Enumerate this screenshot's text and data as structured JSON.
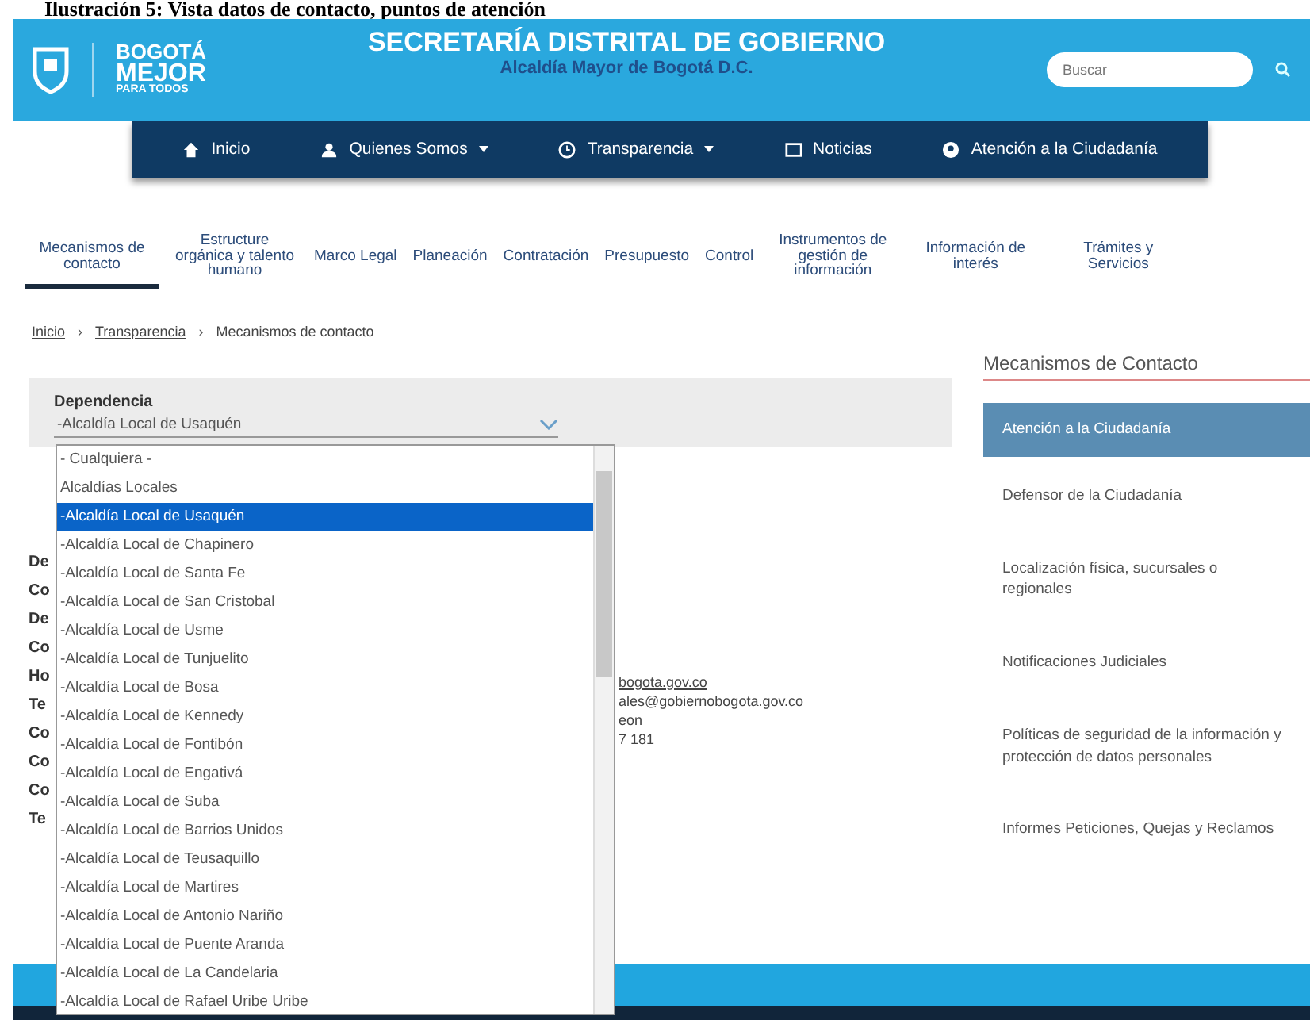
{
  "caption": "Ilustración 5: Vista datos de contacto, puntos de atención",
  "header": {
    "logo_lines": [
      "BOGOTÁ",
      "MEJOR",
      "PARA TODOS"
    ],
    "title": "SECRETARÍA DISTRITAL DE GOBIERNO",
    "subtitle": "Alcaldía Mayor de Bogotá D.C.",
    "search": {
      "placeholder": "Buscar"
    }
  },
  "nav": [
    {
      "label": "Inicio",
      "caret": false
    },
    {
      "label": "Quienes Somos",
      "caret": true
    },
    {
      "label": "Transparencia",
      "caret": true
    },
    {
      "label": "Noticias",
      "caret": false
    },
    {
      "label": "Atención a la Ciudadanía",
      "caret": false
    }
  ],
  "tabs": [
    {
      "label": "Mecanismos de contacto",
      "selected": true
    },
    {
      "label": "Estructure orgánica y talento humano",
      "selected": false
    },
    {
      "label": "Marco Legal",
      "selected": false
    },
    {
      "label": "Planeación",
      "selected": false
    },
    {
      "label": "Contratación",
      "selected": false
    },
    {
      "label": "Presupuesto",
      "selected": false
    },
    {
      "label": "Control",
      "selected": false
    },
    {
      "label": "Instrumentos de gestión de información",
      "selected": false
    },
    {
      "label": "Información de interés",
      "selected": false
    },
    {
      "label": "Trámites y Servicios",
      "selected": false
    }
  ],
  "breadcrumb": [
    {
      "label": "Inicio",
      "link": true
    },
    {
      "separator": "›",
      "label": "Transparencia",
      "link": true
    },
    {
      "separator": "›",
      "label": "Mecanismos de contacto",
      "link": false
    }
  ],
  "filter": {
    "label": "Dependencia",
    "value": "-Alcaldía Local de Usaquén",
    "options": [
      {
        "label": "- Cualquiera -",
        "selected": false
      },
      {
        "label": "Alcaldías Locales",
        "selected": false
      },
      {
        "label": "-Alcaldía Local de Usaquén",
        "selected": true
      },
      {
        "label": "-Alcaldía Local de Chapinero",
        "selected": false
      },
      {
        "label": "-Alcaldía Local de Santa Fe",
        "selected": false
      },
      {
        "label": "-Alcaldía Local de San Cristobal",
        "selected": false
      },
      {
        "label": "-Alcaldía Local de Usme",
        "selected": false
      },
      {
        "label": "-Alcaldía Local de Tunjuelito",
        "selected": false
      },
      {
        "label": "-Alcaldía Local de Bosa",
        "selected": false
      },
      {
        "label": "-Alcaldía Local de Kennedy",
        "selected": false
      },
      {
        "label": "-Alcaldía Local de Fontibón",
        "selected": false
      },
      {
        "label": "-Alcaldía Local de Engativá",
        "selected": false
      },
      {
        "label": "-Alcaldía Local de Suba",
        "selected": false
      },
      {
        "label": "-Alcaldía Local de Barrios Unidos",
        "selected": false
      },
      {
        "label": "-Alcaldía Local de Teusaquillo",
        "selected": false
      },
      {
        "label": "-Alcaldía Local de Martires",
        "selected": false
      },
      {
        "label": "-Alcaldía Local de Antonio Nariño",
        "selected": false
      },
      {
        "label": "-Alcaldía Local de Puente Aranda",
        "selected": false
      },
      {
        "label": "-Alcaldía Local de La Candelaria",
        "selected": false
      },
      {
        "label": "-Alcaldía Local de Rafael Uribe Uribe",
        "selected": false
      }
    ]
  },
  "details": {
    "label_fragments": [
      "De",
      "Co",
      "De",
      "Co",
      "Ho",
      "Te",
      "Co",
      "Co",
      "Co",
      "Te"
    ],
    "value_fragments": [
      {
        "text": "bogota.gov.co",
        "link": true
      },
      {
        "text": "ales@gobiernobogota.gov.co",
        "link": false
      },
      {
        "text": "eon",
        "link": false
      },
      {
        "text": "7 181",
        "link": false
      }
    ]
  },
  "sidebar": {
    "title": "Mecanismos de Contacto",
    "items": [
      {
        "label": "Atención a la Ciudadanía",
        "selected": true
      },
      {
        "label": "Defensor de la Ciudadanía",
        "selected": false
      },
      {
        "label": "Localización física, sucursales o regionales",
        "selected": false
      },
      {
        "label": "Notificaciones Judiciales",
        "selected": false
      },
      {
        "label": "Políticas de seguridad de la información y protección de datos personales",
        "selected": false
      },
      {
        "label": "Informes Peticiones, Quejas y Reclamos",
        "selected": false
      }
    ]
  }
}
